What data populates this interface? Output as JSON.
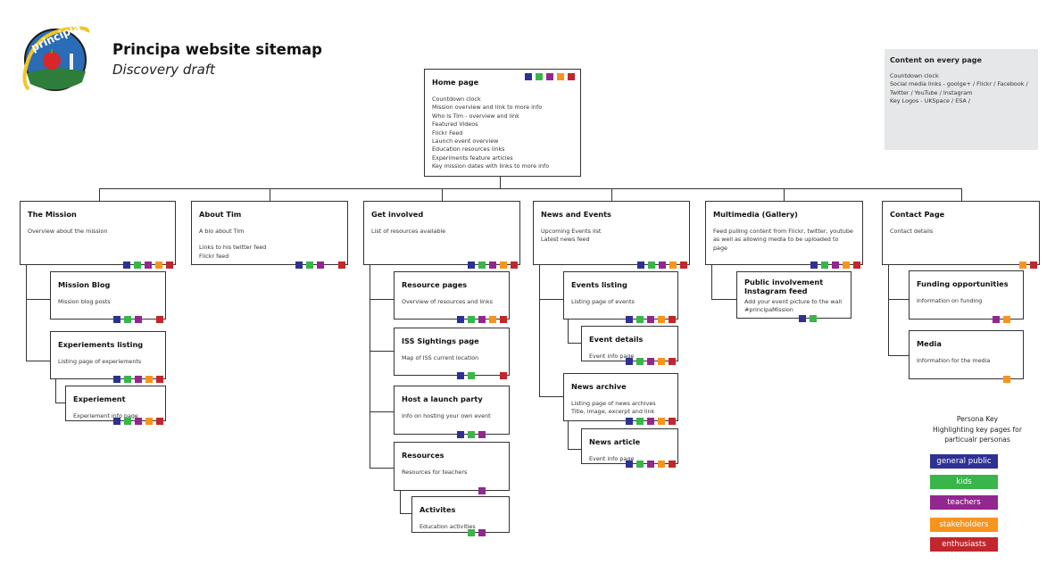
{
  "header": {
    "title": "Principa website sitemap",
    "subtitle": "Discovery draft",
    "logo_text": "principia"
  },
  "persona_colors": [
    "#2e3192",
    "#39b54a",
    "#92278f",
    "#f7941d",
    "#c1272d"
  ],
  "every_page": {
    "title": "Content on every page",
    "lines": [
      "Countdown clock",
      "Social media links - goolge+ /  Flickr / Facebook /",
      "Twitter / YouTube / Instagram",
      "Key Logos - UKSpace / ESA /"
    ]
  },
  "pages": {
    "home": {
      "title": "Home page",
      "lines": [
        "Countdown clock",
        "Mission overview and link to more info",
        "Who is Tim - overview and link",
        "Featured Videos",
        "Flickr Feed",
        "Launch event overview",
        "Education resources links",
        "Experiments feature articles",
        "Key mission dates with links to more info"
      ],
      "personas": [
        1,
        1,
        1,
        1,
        1
      ]
    },
    "mission": {
      "title": "The Mission",
      "lines": [
        "Overview about the mission"
      ],
      "personas": [
        1,
        1,
        1,
        1,
        1
      ]
    },
    "blog": {
      "title": "Mission Blog",
      "lines": [
        "Mission blog posts"
      ],
      "personas": [
        1,
        1,
        1,
        0,
        1
      ]
    },
    "explist": {
      "title": "Experiements listing",
      "lines": [
        "Listing page of experiements"
      ],
      "personas": [
        1,
        1,
        1,
        1,
        1
      ]
    },
    "exp": {
      "title": "Experiement",
      "lines": [
        "Experiement info page"
      ],
      "personas": [
        1,
        1,
        1,
        1,
        1
      ]
    },
    "tim": {
      "title": "About Tim",
      "lines": [
        "A bio about Tim",
        "",
        "Links to his twitter feed",
        "Flickr feed"
      ],
      "personas": [
        1,
        1,
        1,
        0,
        1
      ]
    },
    "getinv": {
      "title": "Get involved",
      "lines": [
        "List of resources available"
      ],
      "personas": [
        1,
        1,
        1,
        1,
        1
      ]
    },
    "respages": {
      "title": "Resource pages",
      "lines": [
        "Overview of resources and links"
      ],
      "personas": [
        1,
        1,
        1,
        1,
        1
      ]
    },
    "iss": {
      "title": "ISS Sightings page",
      "lines": [
        "Map of ISS current location"
      ],
      "personas": [
        1,
        1,
        0,
        0,
        1
      ]
    },
    "host": {
      "title": "Host a launch party",
      "lines": [
        "Info on hosting your own event"
      ],
      "personas": [
        1,
        1,
        1,
        0,
        0
      ]
    },
    "resources": {
      "title": "Resources",
      "lines": [
        "Resources for teachers"
      ],
      "personas": [
        0,
        0,
        1,
        0,
        0
      ]
    },
    "activites": {
      "title": "Activites",
      "lines": [
        "Education activities"
      ],
      "personas": [
        0,
        1,
        1,
        0,
        0
      ]
    },
    "news": {
      "title": "News and Events",
      "lines": [
        "Upcoming Events list",
        "Latest news feed"
      ],
      "personas": [
        1,
        1,
        1,
        1,
        1
      ]
    },
    "events": {
      "title": "Events listing",
      "lines": [
        "Listing page of events"
      ],
      "personas": [
        1,
        1,
        1,
        1,
        1
      ]
    },
    "eventdet": {
      "title": "Event details",
      "lines": [
        "Event info page"
      ],
      "personas": [
        1,
        1,
        1,
        1,
        1
      ]
    },
    "archive": {
      "title": "News archive",
      "lines": [
        "Listing page of news archives",
        "Title, image, excerpt and link"
      ],
      "personas": [
        1,
        1,
        1,
        1,
        1
      ]
    },
    "article": {
      "title": "News article",
      "lines": [
        "Event info page"
      ],
      "personas": [
        1,
        1,
        1,
        1,
        1
      ]
    },
    "multimedia": {
      "title": "Multimedia (Gallery)",
      "lines": [
        "Feed pulling content from Flickr, twitter, youtube",
        "as well as allowing media to be uploaded to",
        "page"
      ],
      "personas": [
        1,
        1,
        1,
        1,
        1
      ]
    },
    "public": {
      "title": "Public involvement Instagram feed",
      "lines": [
        "Add your event picture to the wall",
        "#principaMission"
      ],
      "personas": [
        1,
        1,
        0,
        0,
        0
      ]
    },
    "contact": {
      "title": "Contact Page",
      "lines": [
        "Contact details"
      ],
      "personas": [
        0,
        0,
        0,
        1,
        1
      ]
    },
    "funding": {
      "title": "Funding opportunities",
      "lines": [
        "Information on funding"
      ],
      "personas": [
        0,
        0,
        1,
        1,
        0
      ]
    },
    "media": {
      "title": "Media",
      "lines": [
        "Information for the media"
      ],
      "personas": [
        0,
        0,
        0,
        1,
        0
      ]
    }
  },
  "persona_key": {
    "title": "Persona Key",
    "subtitle": "Highlighting key pages for particualr personas",
    "items": [
      "general public",
      "kids",
      "teachers",
      "stakeholders",
      "enthusiasts"
    ]
  }
}
